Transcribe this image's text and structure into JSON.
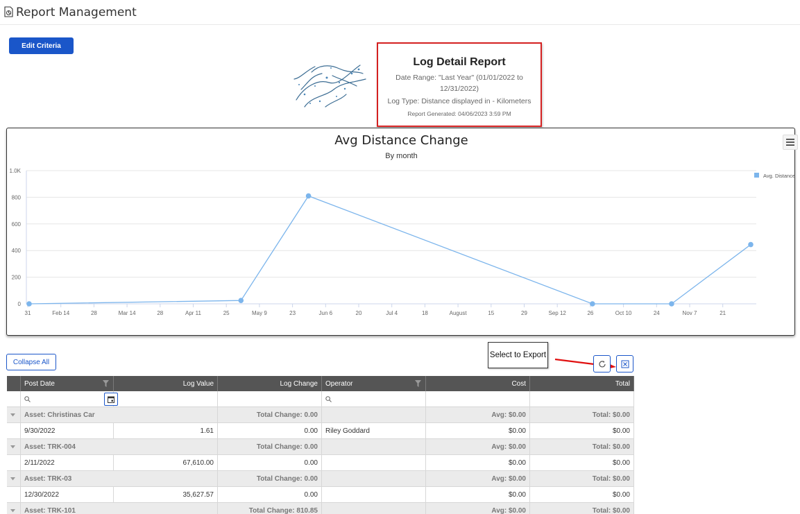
{
  "page": {
    "title": "Report Management",
    "edit_criteria_label": "Edit Criteria",
    "collapse_all_label": "Collapse All",
    "export_note": "Select to Export"
  },
  "report": {
    "title": "Log Detail Report",
    "date_range": "Date Range: \"Last Year\" (01/01/2022 to 12/31/2022)",
    "log_type": "Log Type: Distance displayed in - Kilometers",
    "generated": "Report Generated: 04/06/2023 3:59 PM"
  },
  "chart_data": {
    "type": "line",
    "title": "Avg Distance Change",
    "subtitle": "By month",
    "y_ticks": [
      "0",
      "200",
      "400",
      "600",
      "800",
      "1.0K"
    ],
    "ylim": [
      0,
      1000
    ],
    "x_tick_labels": [
      "31",
      "Feb 14",
      "28",
      "Mar 14",
      "28",
      "Apr 11",
      "25",
      "May 9",
      "23",
      "Jun 6",
      "20",
      "Jul 4",
      "18",
      "August",
      "15",
      "29",
      "Sep 12",
      "26",
      "Oct 10",
      "24",
      "Nov 7",
      "21"
    ],
    "x_range": [
      "2022-01-31",
      "2022-12-07"
    ],
    "series": [
      {
        "name": "Avg. Distance",
        "color": "#7cb5ec",
        "points": [
          {
            "x": "2022-01-31",
            "y": 0
          },
          {
            "x": "2022-05-02",
            "y": 25
          },
          {
            "x": "2022-05-31",
            "y": 810
          },
          {
            "x": "2022-09-30",
            "y": 0
          },
          {
            "x": "2022-11-03",
            "y": 0
          },
          {
            "x": "2022-12-07",
            "y": 445
          }
        ]
      }
    ],
    "legend": "right",
    "grid": true
  },
  "grid": {
    "columns": [
      "Post Date",
      "Log Value",
      "Log Change",
      "Operator",
      "Cost",
      "Total"
    ],
    "groups": [
      {
        "label": "Asset: Christinas Car",
        "total_change": "Total Change: 0.00",
        "avg": "Avg: $0.00",
        "total": "Total: $0.00",
        "rows": [
          {
            "post_date": "9/30/2022",
            "log_value": "1.61",
            "log_change": "0.00",
            "operator": "Riley Goddard",
            "cost": "$0.00",
            "total": "$0.00"
          }
        ]
      },
      {
        "label": "Asset: TRK-004",
        "total_change": "Total Change: 0.00",
        "avg": "Avg: $0.00",
        "total": "Total: $0.00",
        "rows": [
          {
            "post_date": "2/11/2022",
            "log_value": "67,610.00",
            "log_change": "0.00",
            "operator": "",
            "cost": "$0.00",
            "total": "$0.00"
          }
        ]
      },
      {
        "label": "Asset: TRK-03",
        "total_change": "Total Change: 0.00",
        "avg": "Avg: $0.00",
        "total": "Total: $0.00",
        "rows": [
          {
            "post_date": "12/30/2022",
            "log_value": "35,627.57",
            "log_change": "0.00",
            "operator": "",
            "cost": "$0.00",
            "total": "$0.00"
          }
        ]
      },
      {
        "label": "Asset: TRK-101",
        "total_change": "Total Change: 810.85",
        "avg": "Avg: $0.00",
        "total": "Total: $0.00",
        "rows": []
      }
    ]
  },
  "colors": {
    "primary": "#1a56c9",
    "highlight": "#d42020",
    "series": "#7cb5ec",
    "header": "#555555"
  }
}
